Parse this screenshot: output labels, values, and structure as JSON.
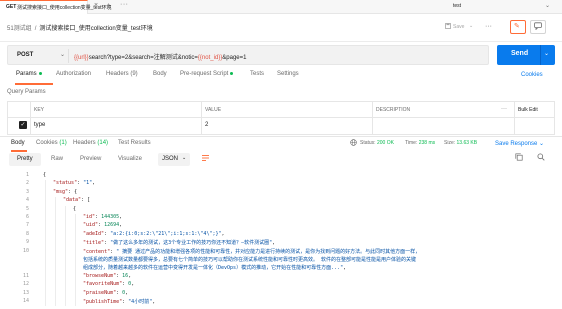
{
  "tabbar": {
    "method": "GET",
    "title": "测试搜索接口_使用collection变量_test环境",
    "close_glyph": "×",
    "add_glyph": "+",
    "more_glyph": "···",
    "environment": "test",
    "env_chevron": "⌄"
  },
  "breadcrumb": {
    "parent": "51测试组",
    "separator": "/",
    "current": "测试搜索接口_使用collection变量_test环境"
  },
  "header_actions": {
    "save_label": "Save",
    "save_icon": "save-icon",
    "more": "···",
    "edit_icon": "pencil-icon",
    "comment_icon": "comment-icon"
  },
  "request": {
    "method": "POST",
    "url_var_prefix": "{{url}}",
    "url_mid": "search?type=2&search=注解测试&notic=",
    "url_var_inline": "{{not_id}}",
    "url_suffix": "&page=1",
    "send_label": "Send"
  },
  "request_tabs": [
    {
      "label": "Params",
      "active": true,
      "dot": true
    },
    {
      "label": "Authorization",
      "active": false
    },
    {
      "label": "Headers (9)",
      "active": false
    },
    {
      "label": "Body",
      "active": false
    },
    {
      "label": "Pre-request Script",
      "active": false,
      "dot": true
    },
    {
      "label": "Tests",
      "active": false
    },
    {
      "label": "Settings",
      "active": false
    }
  ],
  "cookies_link": "Cookies",
  "query_params_label": "Query Params",
  "params_table": {
    "headers": {
      "key": "KEY",
      "value": "VALUE",
      "description": "DESCRIPTION",
      "more": "···",
      "bulk_edit": "Bulk Edit"
    },
    "rows": [
      {
        "checked": true,
        "key": "type",
        "value": "2",
        "description": ""
      }
    ]
  },
  "response_tabs": [
    {
      "label": "Body",
      "active": true
    },
    {
      "label": "Cookies",
      "count": "(1)"
    },
    {
      "label": "Headers",
      "count": "(14)"
    },
    {
      "label": "Test Results",
      "count": ""
    }
  ],
  "response_status": {
    "status_label": "Status:",
    "status_value": "200 OK",
    "time_label": "Time:",
    "time_value": "238 ms",
    "size_label": "Size:",
    "size_value": "13.63 KB",
    "save_response": "Save Response",
    "save_chev": "⌄"
  },
  "view_modes": [
    {
      "label": "Pretty",
      "active": true
    },
    {
      "label": "Raw",
      "active": false
    },
    {
      "label": "Preview",
      "active": false
    },
    {
      "label": "Visualize",
      "active": false
    }
  ],
  "format": {
    "label": "JSON",
    "chevron": "⌄"
  },
  "code_lines": [
    {
      "n": "1",
      "indent": 0,
      "html": "<span class=\"p\">{</span>"
    },
    {
      "n": "2",
      "indent": 1,
      "html": "<span class=\"k\">\"status\"</span><span class=\"p\">: </span><span class=\"s\">\"1\"</span><span class=\"p\">,</span>"
    },
    {
      "n": "3",
      "indent": 1,
      "html": "<span class=\"k\">\"msg\"</span><span class=\"p\">: {</span>"
    },
    {
      "n": "4",
      "indent": 2,
      "html": "<span class=\"k\">\"data\"</span><span class=\"p\">: [</span>"
    },
    {
      "n": "5",
      "indent": 3,
      "html": "<span class=\"p\">{</span>"
    },
    {
      "n": "6",
      "indent": 4,
      "html": "<span class=\"k\">\"id\"</span><span class=\"p\">: </span><span class=\"n\">144305</span><span class=\"p\">,</span>"
    },
    {
      "n": "7",
      "indent": 4,
      "html": "<span class=\"k\">\"uid\"</span><span class=\"p\">: </span><span class=\"n\">12694</span><span class=\"p\">,</span>"
    },
    {
      "n": "8",
      "indent": 4,
      "html": "<span class=\"k\">\"adeId\"</span><span class=\"p\">: </span><span class=\"s\">\"a:2:{i:0;s:2:\\\"21\\\";i:1;s:1:\\\"4\\\";}\"</span><span class=\"p\">,</span>"
    },
    {
      "n": "9",
      "indent": 4,
      "html": "<span class=\"k\">\"title\"</span><span class=\"p\">: </span><span class=\"s\">\"做了这么多年的测试，这3个专业工作的技巧你还不知道？—软件测试圈\"</span><span class=\"p\">,</span>"
    },
    {
      "n": "10",
      "indent": 4,
      "html": "<span class=\"k\">\"content\"</span><span class=\"p\">: </span><span class=\"s\">\"   摘要    通过产品的功能和增强各项的性能和可靠性，并对应能力是进行持续的测试，是你为找到问题的好方法。与此同时其他方面一样，</span>"
    },
    {
      "n": "",
      "indent": 4,
      "html": "<span class=\"s\">包括系统的质量测试数量都要得多，总要有七个简单的技巧可以帮助你在测试系统性能和可靠性时更高效。   软件的在整部可能是性能是用户体验的关键</span>"
    },
    {
      "n": "",
      "indent": 4,
      "html": "<span class=\"s\">组成部分，随着越来越多的软件在运营中变得开发是一体化（DevOps）模式的推动，它开始在性能和可靠性方面...\"</span><span class=\"p\">,</span>"
    },
    {
      "n": "11",
      "indent": 4,
      "html": "<span class=\"k\">\"browseNum\"</span><span class=\"p\">: </span><span class=\"n\">16</span><span class=\"p\">,</span>"
    },
    {
      "n": "12",
      "indent": 4,
      "html": "<span class=\"k\">\"favoriteNum\"</span><span class=\"p\">: </span><span class=\"n\">0</span><span class=\"p\">,</span>"
    },
    {
      "n": "13",
      "indent": 4,
      "html": "<span class=\"k\">\"praiseNum\"</span><span class=\"p\">: </span><span class=\"n\">0</span><span class=\"p\">,</span>"
    },
    {
      "n": "14",
      "indent": 4,
      "html": "<span class=\"k\">\"publishTime\"</span><span class=\"p\">: </span><span class=\"s\">\"4小时前\"</span><span class=\"p\">,</span>"
    }
  ]
}
